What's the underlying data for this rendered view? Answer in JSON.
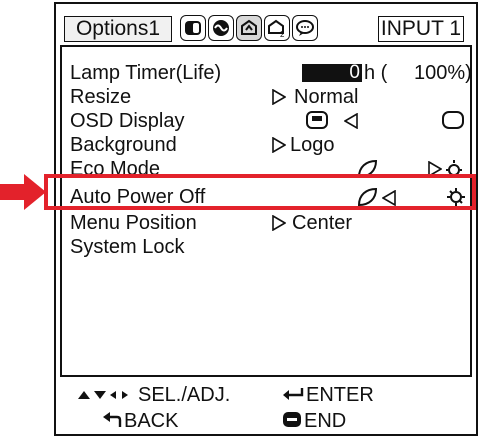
{
  "tabs": {
    "active_label": "Options1",
    "icons": [
      "picture-icon",
      "sound-icon",
      "options1-icon",
      "options2-icon",
      "language-icon"
    ]
  },
  "input_badge": "INPUT 1",
  "menu": {
    "lamp_timer": {
      "label": "Lamp Timer(Life)",
      "hours": "0",
      "unit": "h (",
      "percent": "100%)"
    },
    "resize": {
      "label": "Resize",
      "value": "Normal"
    },
    "osd_display": {
      "label": "OSD Display"
    },
    "background": {
      "label": "Background",
      "value": "Logo"
    },
    "eco_mode": {
      "label": "Eco Mode"
    },
    "auto_power_off": {
      "label": "Auto Power Off"
    },
    "menu_position": {
      "label": "Menu Position",
      "value": "Center"
    },
    "system_lock": {
      "label": "System Lock"
    }
  },
  "footer": {
    "select_adjust": "SEL./ADJ.",
    "enter": "ENTER",
    "back": "BACK",
    "end": "END"
  },
  "colors": {
    "highlight": "#e3222b",
    "pointer": "#e3222b"
  }
}
